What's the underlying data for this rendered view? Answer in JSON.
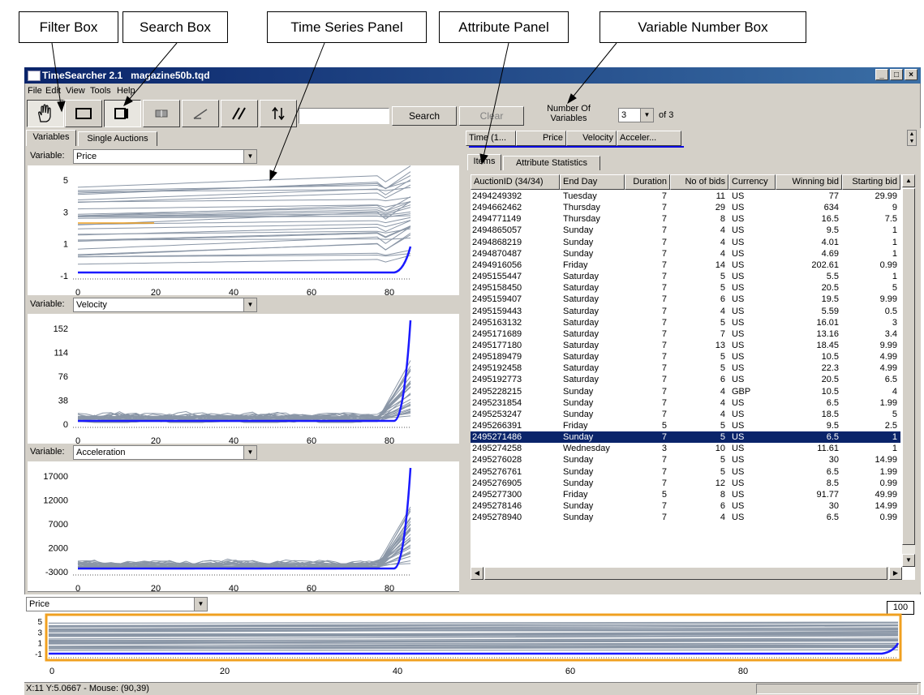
{
  "callouts": {
    "filter_box": "Filter Box",
    "search_box": "Search Box",
    "time_series_panel": "Time Series Panel",
    "attribute_panel": "Attribute Panel",
    "variable_number_box": "Variable Number Box"
  },
  "window": {
    "title": "TimeSearcher 2.1   magazine50b.tqd",
    "controls": [
      "_",
      "□",
      "×"
    ]
  },
  "menu": [
    "File",
    "Edit",
    "View",
    "Tools",
    "Help"
  ],
  "toolbar": {
    "search_label": "Search",
    "clear_label": "Clear",
    "num_vars_label": "Number Of Variables",
    "num_vars_value": "3",
    "num_vars_of": "of 3"
  },
  "left_tabs": [
    "Variables",
    "Single Auctions"
  ],
  "panels": [
    {
      "label": "Variable:",
      "selected": "Price",
      "yticks": [
        "5",
        "3",
        "1",
        "-1"
      ],
      "xticks": [
        "0",
        "20",
        "40",
        "60",
        "80"
      ]
    },
    {
      "label": "Variable:",
      "selected": "Velocity",
      "yticks": [
        "152",
        "114",
        "76",
        "38",
        "0"
      ],
      "xticks": [
        "0",
        "20",
        "40",
        "60",
        "80"
      ]
    },
    {
      "label": "Variable:",
      "selected": "Acceleration",
      "yticks": [
        "17000",
        "12000",
        "7000",
        "2000",
        "-3000"
      ],
      "xticks": [
        "0",
        "20",
        "40",
        "60",
        "80"
      ]
    }
  ],
  "attr_columns_top": [
    "Time (1...",
    "Price",
    "Velocity",
    "Acceler..."
  ],
  "right_tabs": [
    "Items",
    "Attribute Statistics"
  ],
  "table": {
    "columns": [
      "AuctionID (34/34)",
      "End Day",
      "Duration",
      "No of bids",
      "Currency",
      "Winning bid",
      "Starting bid"
    ],
    "rows": [
      [
        "2494249392",
        "Tuesday",
        "7",
        "11",
        "US",
        "77",
        "29.99"
      ],
      [
        "2494662462",
        "Thursday",
        "7",
        "29",
        "US",
        "634",
        "9"
      ],
      [
        "2494771149",
        "Thursday",
        "7",
        "8",
        "US",
        "16.5",
        "7.5"
      ],
      [
        "2494865057",
        "Sunday",
        "7",
        "4",
        "US",
        "9.5",
        "1"
      ],
      [
        "2494868219",
        "Sunday",
        "7",
        "4",
        "US",
        "4.01",
        "1"
      ],
      [
        "2494870487",
        "Sunday",
        "7",
        "4",
        "US",
        "4.69",
        "1"
      ],
      [
        "2494916056",
        "Friday",
        "7",
        "14",
        "US",
        "202.61",
        "0.99"
      ],
      [
        "2495155447",
        "Saturday",
        "7",
        "5",
        "US",
        "5.5",
        "1"
      ],
      [
        "2495158450",
        "Saturday",
        "7",
        "5",
        "US",
        "20.5",
        "5"
      ],
      [
        "2495159407",
        "Saturday",
        "7",
        "6",
        "US",
        "19.5",
        "9.99"
      ],
      [
        "2495159443",
        "Saturday",
        "7",
        "4",
        "US",
        "5.59",
        "0.5"
      ],
      [
        "2495163132",
        "Saturday",
        "7",
        "5",
        "US",
        "16.01",
        "3"
      ],
      [
        "2495171689",
        "Saturday",
        "7",
        "7",
        "US",
        "13.16",
        "3.4"
      ],
      [
        "2495177180",
        "Saturday",
        "7",
        "13",
        "US",
        "18.45",
        "9.99"
      ],
      [
        "2495189479",
        "Saturday",
        "7",
        "5",
        "US",
        "10.5",
        "4.99"
      ],
      [
        "2495192458",
        "Saturday",
        "7",
        "5",
        "US",
        "22.3",
        "4.99"
      ],
      [
        "2495192773",
        "Saturday",
        "7",
        "6",
        "US",
        "20.5",
        "6.5"
      ],
      [
        "2495228215",
        "Sunday",
        "7",
        "4",
        "GBP",
        "10.5",
        "4"
      ],
      [
        "2495231854",
        "Sunday",
        "7",
        "4",
        "US",
        "6.5",
        "1.99"
      ],
      [
        "2495253247",
        "Sunday",
        "7",
        "4",
        "US",
        "18.5",
        "5"
      ],
      [
        "2495266391",
        "Friday",
        "5",
        "5",
        "US",
        "9.5",
        "2.5"
      ],
      [
        "2495271486",
        "Sunday",
        "7",
        "5",
        "US",
        "6.5",
        "1"
      ],
      [
        "2495274258",
        "Wednesday",
        "3",
        "10",
        "US",
        "11.61",
        "1"
      ],
      [
        "2495276028",
        "Sunday",
        "7",
        "5",
        "US",
        "30",
        "14.99"
      ],
      [
        "2495276761",
        "Sunday",
        "7",
        "5",
        "US",
        "6.5",
        "1.99"
      ],
      [
        "2495276905",
        "Sunday",
        "7",
        "12",
        "US",
        "8.5",
        "0.99"
      ],
      [
        "2495277300",
        "Friday",
        "5",
        "8",
        "US",
        "91.77",
        "49.99"
      ],
      [
        "2495278146",
        "Sunday",
        "7",
        "6",
        "US",
        "30",
        "14.99"
      ],
      [
        "2495278940",
        "Sunday",
        "7",
        "4",
        "US",
        "6.5",
        "0.99"
      ]
    ],
    "selected_row": 21
  },
  "overview": {
    "selected": "Price",
    "zoom_value": "100",
    "yticks": [
      "5",
      "3",
      "1",
      "-1"
    ],
    "xticks": [
      "0",
      "20",
      "40",
      "60",
      "80"
    ]
  },
  "status": "X:11 Y:5.0667 - Mouse: (90,39)",
  "colors": {
    "highlight": "#1a1aff",
    "lines": "#8a96a6",
    "orange": "#f0a020",
    "selection": "#0a246a"
  }
}
